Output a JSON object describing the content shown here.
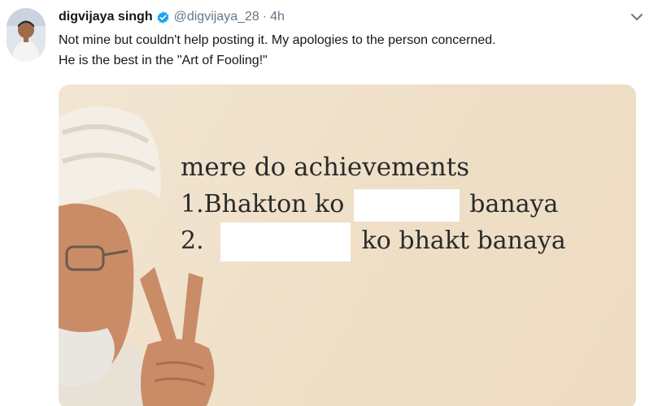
{
  "tweet": {
    "display_name": "digvijaya singh",
    "handle": "@digvijaya_28",
    "separator": "·",
    "time": "4h",
    "text_line_1": "Not mine but couldn't help posting it. My apologies to the person concerned.",
    "text_line_2": "He is the best in the \"Art of Fooling!\"",
    "verified_icon": "verified-badge-icon",
    "menu_icon": "chevron-down-icon"
  },
  "media": {
    "heading": "mere do achievements",
    "line_1_prefix": "1.Bhakton ko",
    "line_1_suffix": "banaya",
    "line_2_prefix": "2.",
    "line_2_suffix": "ko bhakt banaya"
  },
  "colors": {
    "text": "#14171a",
    "secondary": "#657786",
    "verified": "#1da1f2",
    "meme_background": "#efe0c8"
  }
}
